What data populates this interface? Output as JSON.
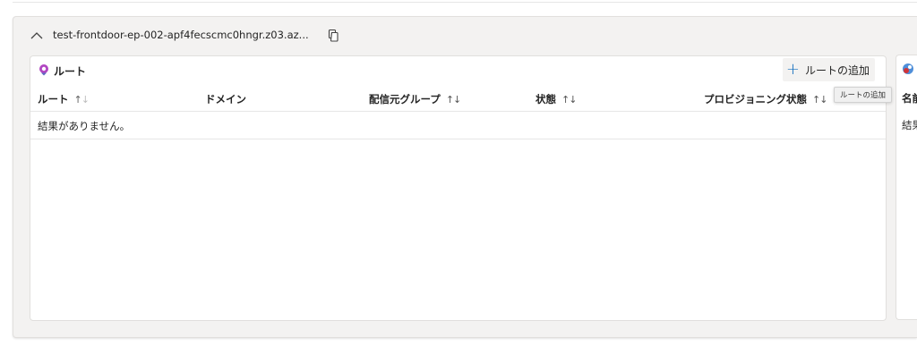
{
  "endpoint": {
    "name": "test-frontdoor-ep-002-apf4fecscmc0hngr.z03.az..."
  },
  "routes_panel": {
    "title": "ルート",
    "add_button_label": "ルートの追加",
    "tooltip": "ルートの追加",
    "columns": [
      "ルート",
      "ドメイン",
      "配信元グループ",
      "状態",
      "プロビジョニング状態"
    ],
    "sort_glyph_up": "↑",
    "sort_glyph_down": "↓",
    "empty_message": "結果がありません。"
  },
  "origin_panel": {
    "column_partial": "名前",
    "empty_partial": "結果"
  },
  "colors": {
    "accent": "#0f6cbd",
    "panel_bg": "#f3f2f1"
  }
}
